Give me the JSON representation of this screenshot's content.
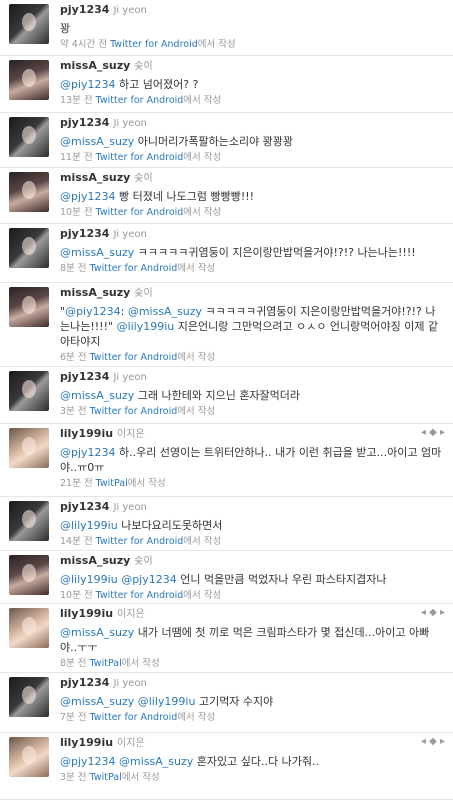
{
  "tweets": [
    {
      "user": "pjy1234",
      "full": "Ji yeon",
      "avatar": "pjy",
      "segments": [
        {
          "t": "꽝",
          "m": false
        }
      ],
      "time": "약 4시간 전",
      "source": "Twitter for Android",
      "suffix": "에서 작성"
    },
    {
      "user": "missA_suzy",
      "full": "숮이",
      "avatar": "suzy",
      "segments": [
        {
          "t": "@piy1234",
          "m": true
        },
        {
          "t": " 하고 넘어졌어? ?",
          "m": false
        }
      ],
      "time": "13분 전",
      "source": "Twitter for Android",
      "suffix": "에서 작성"
    },
    {
      "user": "pjy1234",
      "full": "Ji yeon",
      "avatar": "pjy",
      "segments": [
        {
          "t": "@missA_suzy",
          "m": true
        },
        {
          "t": " 아니머리가폭팔하는소리야 꽝꽝꽝",
          "m": false
        }
      ],
      "time": "11분 전",
      "source": "Twitter for Android",
      "suffix": "에서 작성"
    },
    {
      "user": "missA_suzy",
      "full": "숮이",
      "avatar": "suzy",
      "segments": [
        {
          "t": "@pjy1234",
          "m": true
        },
        {
          "t": " 빵 터졌네 나도그럼 빵빵빵!!!",
          "m": false
        }
      ],
      "time": "10분 전",
      "source": "Twitter for Android",
      "suffix": "에서 작성"
    },
    {
      "user": "pjy1234",
      "full": "Ji yeon",
      "avatar": "pjy",
      "segments": [
        {
          "t": "@missA_suzy",
          "m": true
        },
        {
          "t": " ㅋㅋㅋㅋㅋ귀염둥이 지은이랑만밥먹을거야!?!? 나는나는!!!!",
          "m": false
        }
      ],
      "time": "8분 전",
      "source": "Twitter for Android",
      "suffix": "에서 작성"
    },
    {
      "user": "missA_suzy",
      "full": "숮이",
      "avatar": "suzy",
      "segments": [
        {
          "t": "\"",
          "m": false
        },
        {
          "t": "@piy1234",
          "m": true
        },
        {
          "t": ": ",
          "m": false
        },
        {
          "t": "@missA_suzy",
          "m": true
        },
        {
          "t": " ㅋㅋㅋㅋㅋ귀염둥이 지은이랑만밥먹을거야!?!? 나는나는!!!!\" ",
          "m": false
        },
        {
          "t": "@lily199iu",
          "m": true
        },
        {
          "t": " 지은언니랑 그만먹으려고 ㅇㅅㅇ 언니랑먹어야징 이제 같아타야지",
          "m": false
        }
      ],
      "time": "6분 전",
      "source": "Twitter for Android",
      "suffix": "에서 작성"
    },
    {
      "user": "pjy1234",
      "full": "Ji yeon",
      "avatar": "pjy",
      "segments": [
        {
          "t": "@missA_suzy",
          "m": true
        },
        {
          "t": " 그래 나한테와 지으닌 혼자잘먹더라",
          "m": false
        }
      ],
      "time": "3분 전",
      "source": "Twitter for Android",
      "suffix": "에서 작성"
    },
    {
      "user": "lily199iu",
      "full": "이지은",
      "avatar": "lily",
      "segments": [
        {
          "t": "@pjy1234",
          "m": true
        },
        {
          "t": " 하..우리 선영이는 트위터안하나.. 내가 이런 취급을 받고...아이고 엄마야..ㅠ0ㅠ",
          "m": false
        }
      ],
      "time": "21분 전",
      "source": "TwitPal",
      "suffix": "에서 작성",
      "actions": "◂ ◆ ▸"
    },
    {
      "user": "pjy1234",
      "full": "Ji yeon",
      "avatar": "pjy",
      "segments": [
        {
          "t": "@lily199iu",
          "m": true
        },
        {
          "t": " 나보다요리도못하면서",
          "m": false
        }
      ],
      "time": "14분 전",
      "source": "Twitter for Android",
      "suffix": "에서 작성"
    },
    {
      "user": "missA_suzy",
      "full": "숮이",
      "avatar": "suzy",
      "segments": [
        {
          "t": "@lily199iu",
          "m": true
        },
        {
          "t": " ",
          "m": false
        },
        {
          "t": "@pjy1234",
          "m": true
        },
        {
          "t": " 언니 먹을만큼 먹었자나 우린 파스타지겹자나",
          "m": false
        }
      ],
      "time": "10분 전",
      "source": "Twitter for Android",
      "suffix": "에서 작성"
    },
    {
      "user": "lily199iu",
      "full": "이지은",
      "avatar": "lily",
      "segments": [
        {
          "t": "@missA_suzy",
          "m": true
        },
        {
          "t": " 내가 너땜에 첫 끼로 먹은 크림파스타가 몇 접신데...아이고 아빠야..ㅜㅜ",
          "m": false
        }
      ],
      "time": "8분 전",
      "source": "TwitPal",
      "suffix": "에서 작성",
      "actions": "◂ ◆ ▸"
    },
    {
      "user": "pjy1234",
      "full": "Ji yeon",
      "avatar": "pjy",
      "segments": [
        {
          "t": "@missA_suzy",
          "m": true
        },
        {
          "t": " ",
          "m": false
        },
        {
          "t": "@lily199iu",
          "m": true
        },
        {
          "t": " 고기먹자 수지야",
          "m": false
        }
      ],
      "time": "7분 전",
      "source": "Twitter for Android",
      "suffix": "에서 작성"
    },
    {
      "user": "lily199iu",
      "full": "이지은",
      "avatar": "lily",
      "segments": [
        {
          "t": "@pjy1234",
          "m": true
        },
        {
          "t": " ",
          "m": false
        },
        {
          "t": "@missA_suzy",
          "m": true
        },
        {
          "t": " 혼자있고 싶다..다 나가줘..",
          "m": false
        }
      ],
      "time": "3분 전",
      "source": "TwitPal",
      "suffix": "에서 작성",
      "actions": "◂ ◆ ▸"
    }
  ]
}
